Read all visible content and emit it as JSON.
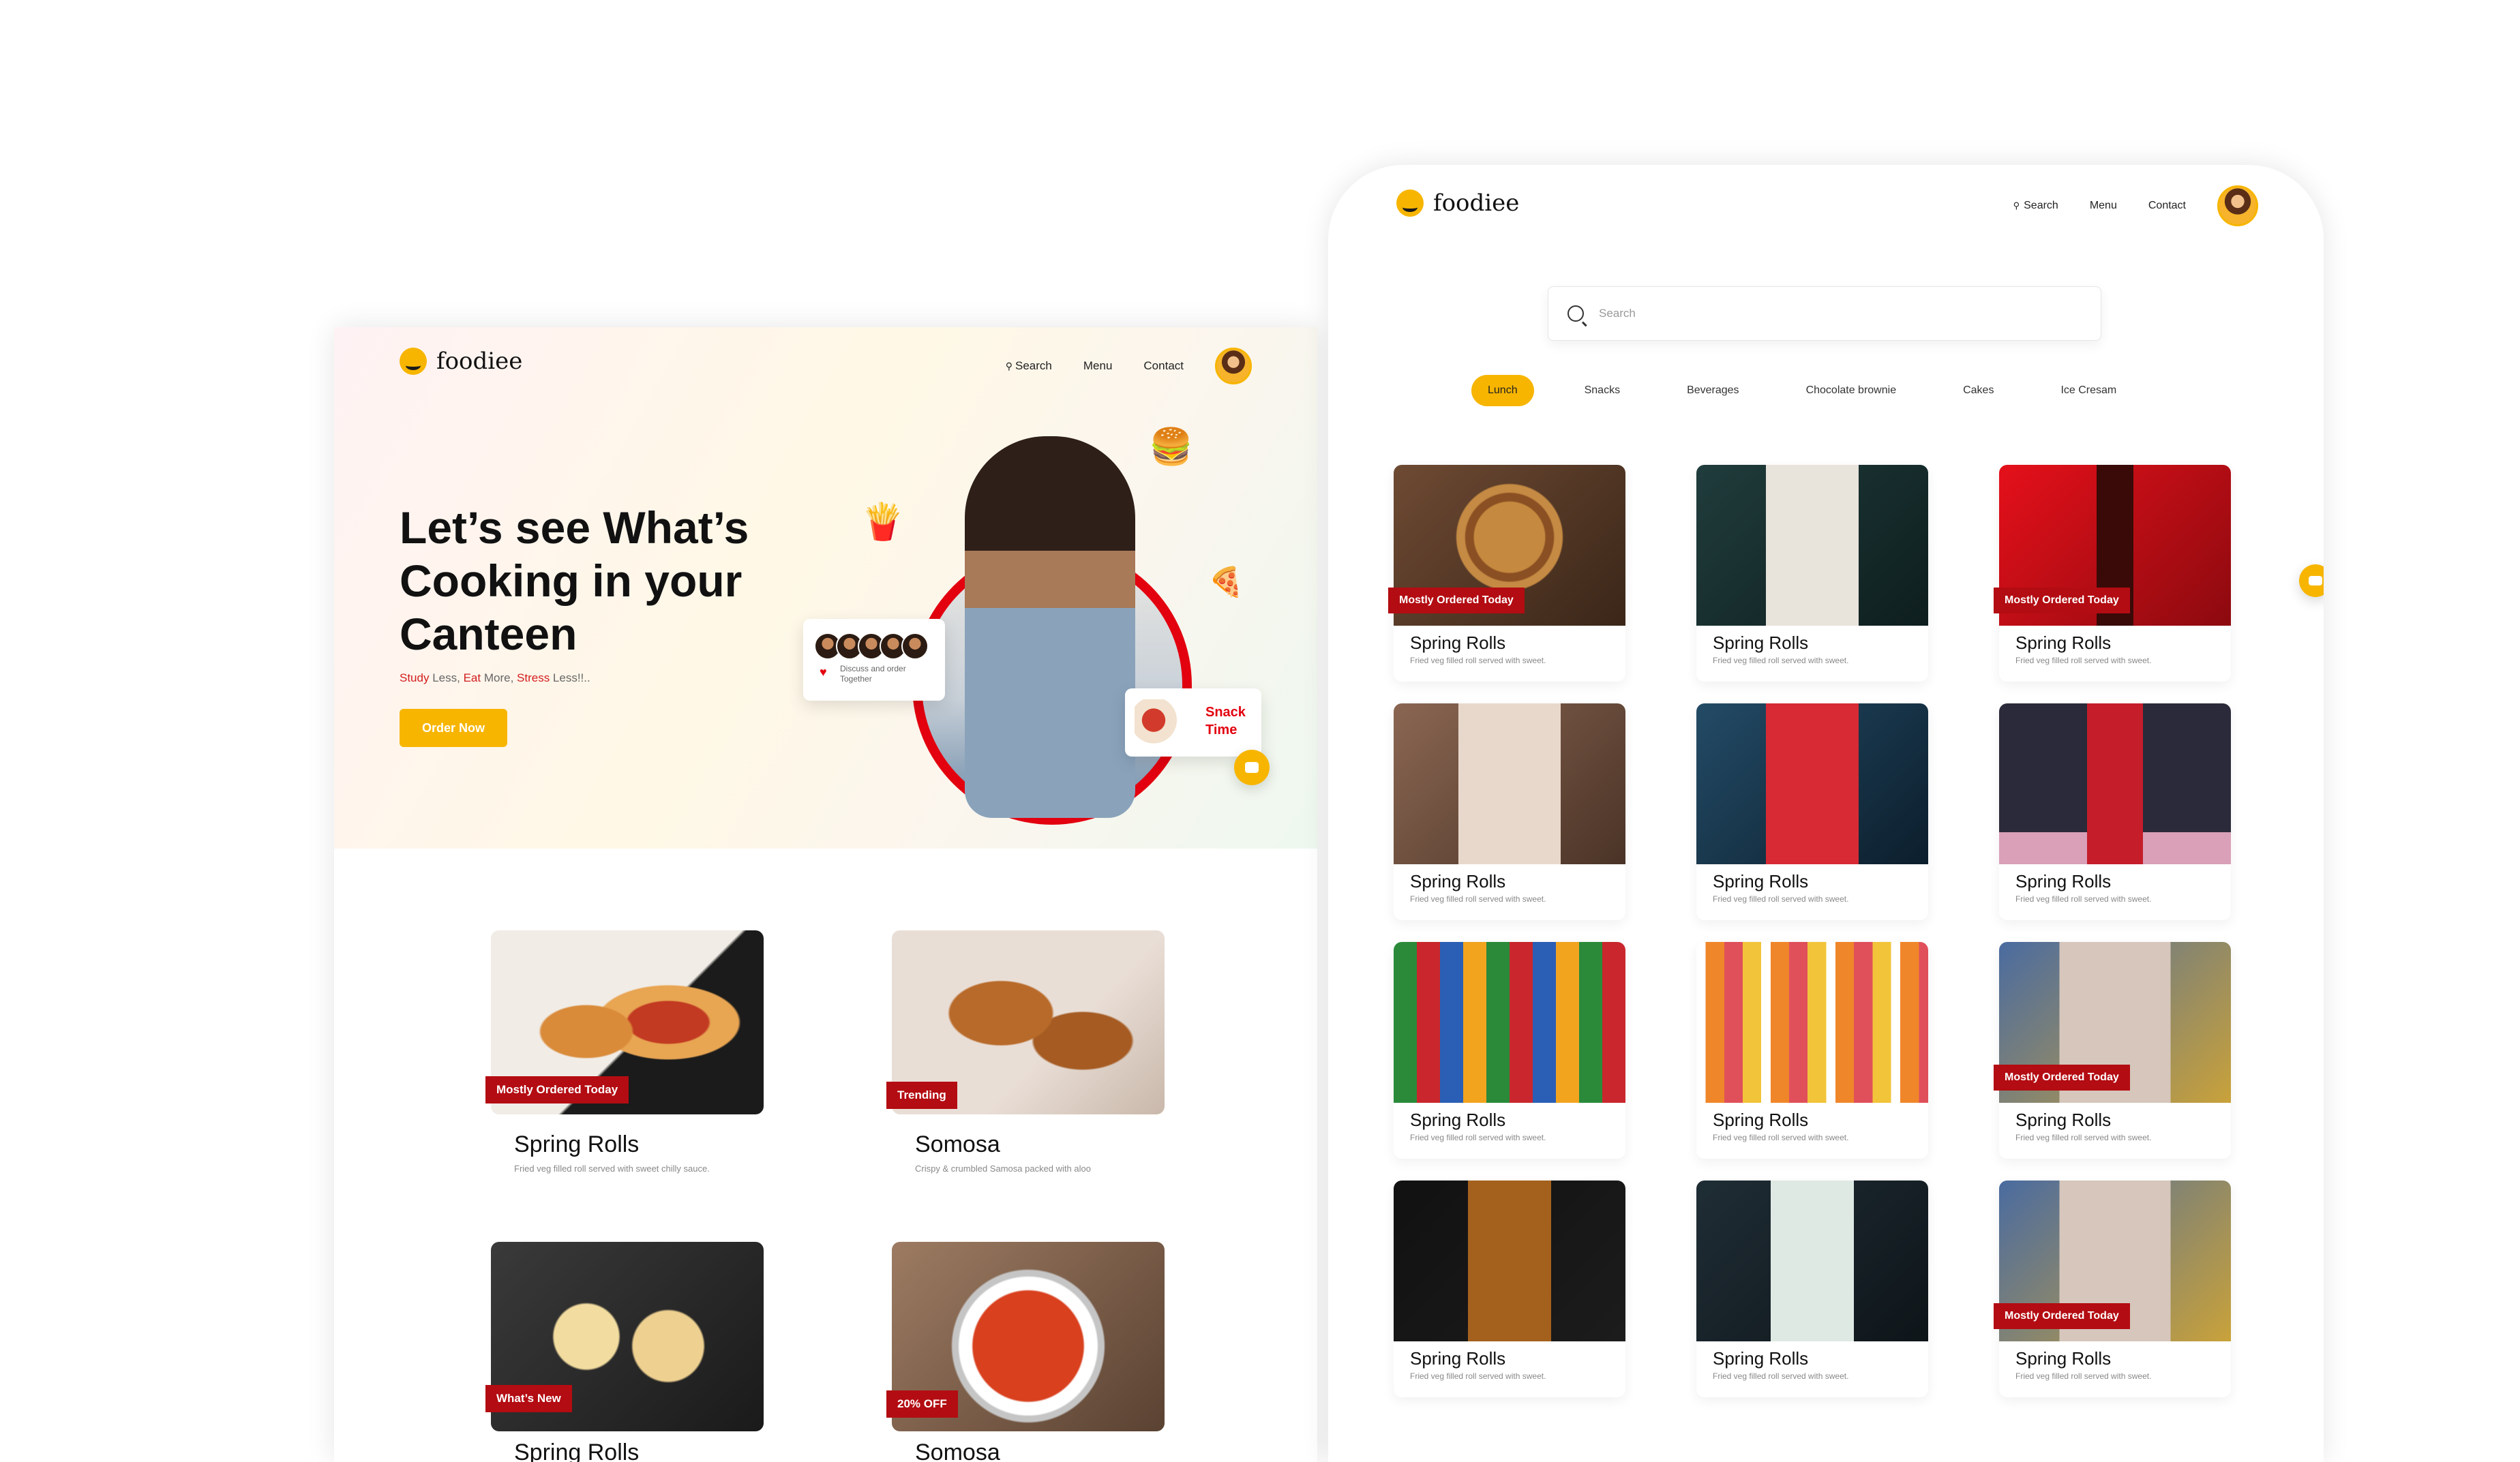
{
  "desktop": {
    "brand": "foodiee",
    "nav": {
      "search": "Search",
      "menu": "Menu",
      "contact": "Contact"
    },
    "hero": {
      "title": "Let’s see What’s Cooking in your Canteen",
      "sub_study": "Study",
      "sub_less1": " Less, ",
      "sub_eat": "Eat",
      "sub_more": " More, ",
      "sub_stress": "Stress",
      "sub_less2": " Less!!..",
      "cta": "Order Now",
      "discuss": "Discuss and order Together",
      "snack": "Snack Time"
    },
    "cards": [
      {
        "tag": "Mostly Ordered Today",
        "name": "Spring Rolls",
        "desc": "Fried veg filled roll served with sweet chilly sauce."
      },
      {
        "tag": "Trending",
        "name": "Somosa",
        "desc": "Crispy & crumbled Samosa packed with aloo"
      },
      {
        "tag": "What’s New",
        "name": "Spring Rolls",
        "desc": ""
      },
      {
        "tag": "20% OFF",
        "name": "Somosa",
        "desc": ""
      }
    ]
  },
  "tablet": {
    "brand": "foodiee",
    "nav": {
      "search": "Search",
      "menu": "Menu",
      "contact": "Contact"
    },
    "search_placeholder": "Search",
    "categories": [
      "Lunch",
      "Snacks",
      "Beverages",
      "Chocolate brownie",
      "Cakes",
      "Ice Cresam"
    ],
    "active_category": "Lunch",
    "items": [
      {
        "name": "Spring Rolls",
        "desc": "Fried veg filled roll served with sweet.",
        "tag": "Mostly Ordered Today"
      },
      {
        "name": "Spring Rolls",
        "desc": "Fried veg filled roll served with sweet.",
        "tag": ""
      },
      {
        "name": "Spring Rolls",
        "desc": "Fried veg filled roll served with sweet.",
        "tag": "Mostly Ordered Today"
      },
      {
        "name": "Spring Rolls",
        "desc": "Fried veg filled roll served with sweet.",
        "tag": ""
      },
      {
        "name": "Spring Rolls",
        "desc": "Fried veg filled roll served with sweet.",
        "tag": ""
      },
      {
        "name": "Spring Rolls",
        "desc": "Fried veg filled roll served with sweet.",
        "tag": ""
      },
      {
        "name": "Spring Rolls",
        "desc": "Fried veg filled roll served with sweet.",
        "tag": ""
      },
      {
        "name": "Spring Rolls",
        "desc": "Fried veg filled roll served with sweet.",
        "tag": ""
      },
      {
        "name": "Spring Rolls",
        "desc": "Fried veg filled roll served with sweet.",
        "tag": "Mostly Ordered Today"
      },
      {
        "name": "Spring Rolls",
        "desc": "Fried veg filled roll served with sweet.",
        "tag": ""
      },
      {
        "name": "Spring Rolls",
        "desc": "Fried veg filled roll served with sweet.",
        "tag": ""
      },
      {
        "name": "Spring Rolls",
        "desc": "Fried veg filled roll served with sweet.",
        "tag": "Mostly Ordered Today"
      }
    ]
  },
  "colors": {
    "accent": "#f7b500",
    "tag": "#b30c12",
    "hero_red": "#e3000f"
  },
  "icons": [
    "logo-icon",
    "search-icon",
    "cart-icon",
    "chat-icon",
    "heart-icon"
  ]
}
